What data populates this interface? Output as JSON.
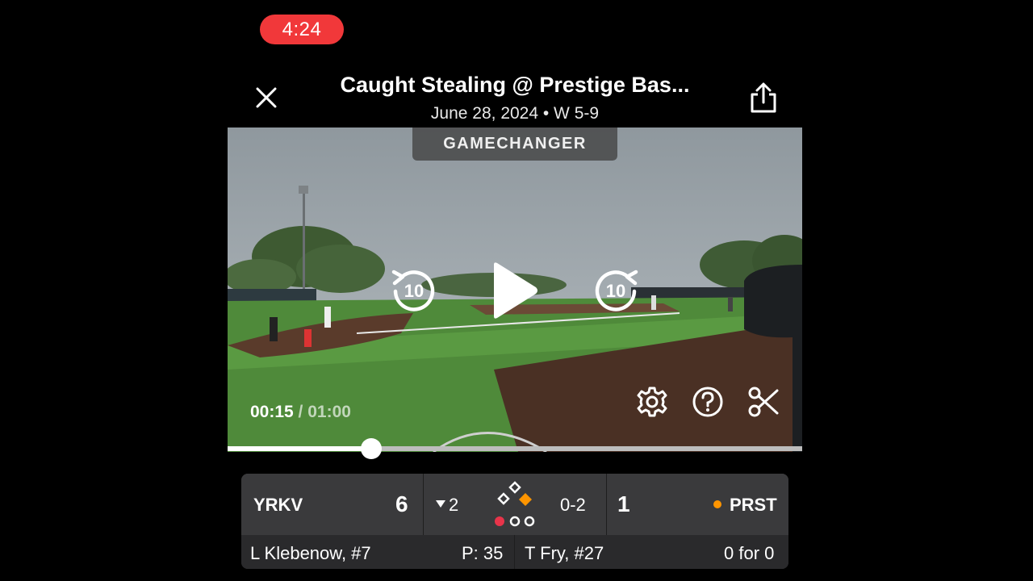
{
  "status": {
    "time": "4:24",
    "accent_color": "#f1383a"
  },
  "header": {
    "title": "Caught Stealing @ Prestige Bas...",
    "subtitle": "June 28, 2024 • W 5-9"
  },
  "video": {
    "watermark": "GAMECHANGER",
    "rewind_label": "10",
    "forward_label": "10",
    "current_time": "00:15",
    "separator": " / ",
    "total_time": "01:00",
    "progress_fraction": 0.25
  },
  "scoreboard": {
    "away": {
      "abbr": "YRKV",
      "score": "6"
    },
    "inning": "2",
    "inning_half": "bottom",
    "count": "0-2",
    "home": {
      "abbr": "PRST",
      "score": "1",
      "batting_indicator_color": "#ff9500"
    },
    "bases": {
      "first": true,
      "second": false,
      "third": false
    },
    "outs": 1,
    "pitcher": {
      "name": "L Klebenow, #7",
      "stat": "P: 35"
    },
    "batter": {
      "name": "T Fry, #27",
      "stat": "0 for 0"
    }
  }
}
